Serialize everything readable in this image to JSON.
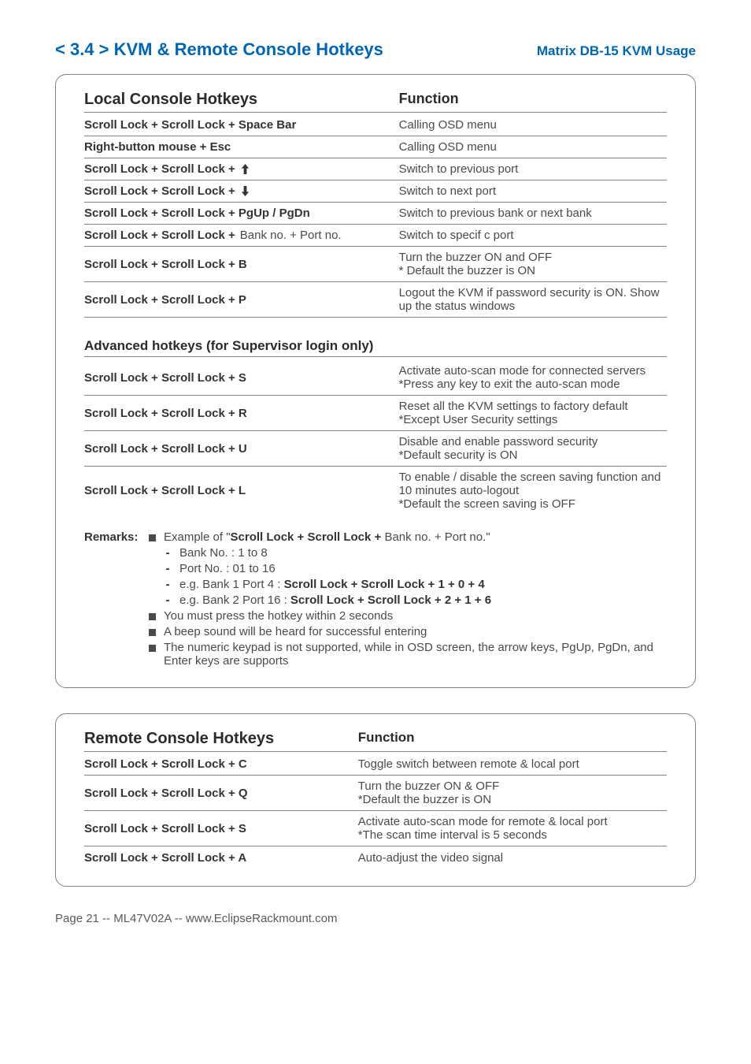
{
  "header": {
    "left": "< 3.4 > KVM & Remote Console Hotkeys",
    "right": "Matrix  DB-15 KVM Usage"
  },
  "local": {
    "title": "Local Console Hotkeys",
    "funcTitle": "Function",
    "rows": [
      {
        "hk": "Scroll Lock  +  Scroll Lock  +   Space Bar",
        "fn": "Calling OSD menu",
        "arrow": ""
      },
      {
        "hk": "Right-button mouse  +  Esc",
        "fn": "Calling OSD menu",
        "arrow": ""
      },
      {
        "hk": "Scroll Lock  +  Scroll Lock  +",
        "fn": "Switch to previous port",
        "arrow": "up"
      },
      {
        "hk": "Scroll Lock  +  Scroll Lock  +",
        "fn": "Switch to next port",
        "arrow": "down"
      },
      {
        "hk": "Scroll Lock  +  Scroll Lock  +   PgUp / PgDn",
        "fn": "Switch to previous bank or next bank",
        "arrow": ""
      },
      {
        "hk_bold": "Scroll Lock  +  Scroll Lock  +",
        "hk_plain": "   Bank no.  +  Port no.",
        "fn": "Switch to specif c port",
        "arrow": ""
      },
      {
        "hk": "Scroll Lock  +  Scroll Lock  +   B",
        "fn": "Turn the buzzer ON and OFF\n* Default the buzzer is ON",
        "arrow": ""
      },
      {
        "hk": "Scroll Lock  +  Scroll Lock  +   P",
        "fn": "Logout the KVM if password security is ON.  Show up the status windows",
        "arrow": ""
      }
    ],
    "advTitle": "Advanced hotkeys (for Supervisor login only)",
    "advRows": [
      {
        "hk": "Scroll Lock  +  Scroll Lock  +   S",
        "fn": "Activate auto-scan mode for connected servers\n*Press any key to exit the auto-scan mode"
      },
      {
        "hk": "Scroll Lock  +  Scroll Lock  +   R",
        "fn": "Reset all the KVM settings to factory default\n*Except User Security settings"
      },
      {
        "hk": "Scroll Lock  +  Scroll Lock  +   U",
        "fn": "Disable and enable password security\n*Default security is ON"
      },
      {
        "hk": "Scroll Lock  +  Scroll Lock  +   L",
        "fn": "To enable / disable the screen saving function and 10 minutes auto-logout\n*Default the screen saving is OFF"
      }
    ],
    "remarks": {
      "label": "Remarks:",
      "b1a": "Example of \"",
      "b1b": "Scroll Lock  +  Scroll Lock  +",
      "b1c": "  Bank no.  +  Port no.\"",
      "d1": "Bank No. :  1 to 8",
      "d2": "Port No. :  01 to 16",
      "d3a": "e.g. Bank 1 Port 4 :  ",
      "d3b": "Scroll Lock   +   Scroll Lock   +   1   +   0   +   4",
      "d4a": "e.g. Bank 2 Port 16 :  ",
      "d4b": "Scroll Lock   +   Scroll Lock   +   2   +   1   +   6",
      "b2": "You must press the hotkey within 2 seconds",
      "b3": "A beep sound will be heard for successful entering",
      "b4": "The numeric keypad is not supported, while in OSD screen, the arrow keys, PgUp, PgDn, and Enter keys are supports"
    }
  },
  "remote": {
    "title": "Remote Console Hotkeys",
    "funcTitle": "Function",
    "rows": [
      {
        "hk": "Scroll Lock  +  Scroll Lock  +   C",
        "fn": "Toggle switch between remote & local port"
      },
      {
        "hk": "Scroll Lock  +  Scroll Lock  +   Q",
        "fn": "Turn the buzzer ON & OFF\n*Default the buzzer is ON"
      },
      {
        "hk": "Scroll Lock  +  Scroll Lock  +   S",
        "fn": "Activate auto-scan mode for remote & local port\n*The scan time interval is 5 seconds"
      },
      {
        "hk": "Scroll Lock  +  Scroll Lock  +   A",
        "fn": "Auto-adjust the video signal"
      }
    ]
  },
  "footer": "Page 21 -- ML47V02A -- www.EclipseRackmount.com"
}
